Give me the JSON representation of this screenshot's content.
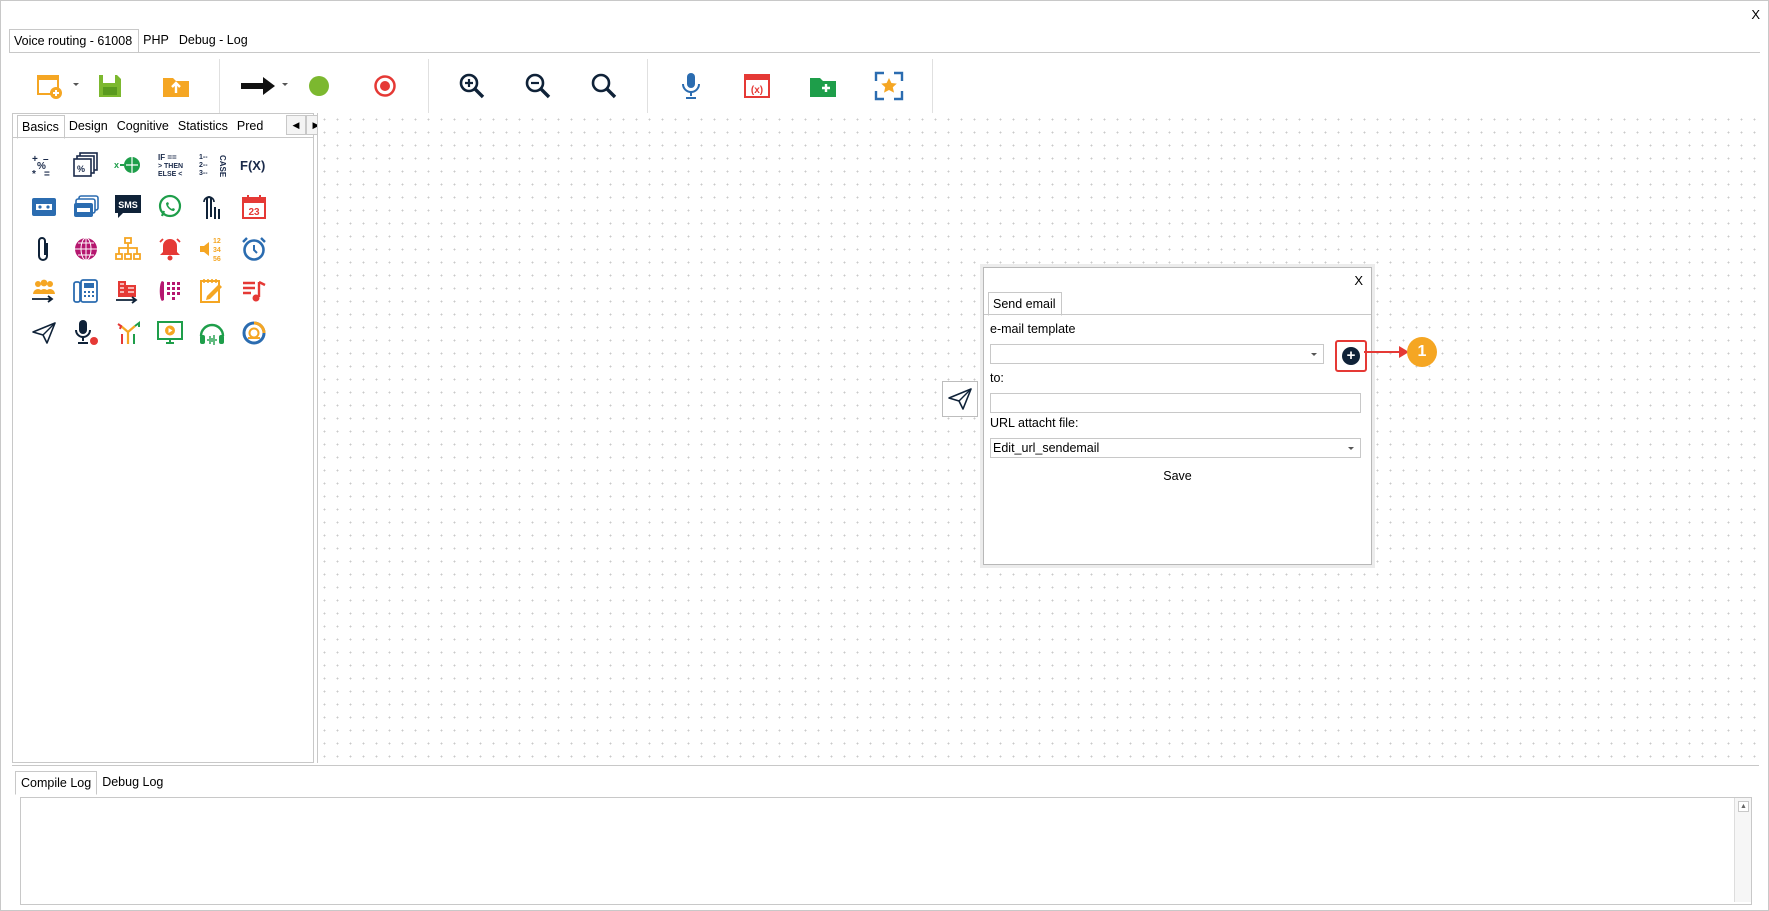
{
  "window": {
    "close_label": "X"
  },
  "top_tabs": [
    {
      "label": "Voice routing - 61008",
      "active": true
    },
    {
      "label": "PHP",
      "active": false
    },
    {
      "label": "Debug - Log",
      "active": false
    }
  ],
  "toolbar": {
    "icons": [
      "new-diagram-icon",
      "save-icon",
      "upload-folder-icon",
      "arrow-right-icon",
      "start-dot-icon",
      "stop-target-icon",
      "zoom-in-icon",
      "zoom-out-icon",
      "zoom-reset-icon",
      "microphone-icon",
      "variables-icon",
      "add-folder-icon",
      "fit-to-screen-icon"
    ]
  },
  "left_panel": {
    "tabs": [
      {
        "label": "Basics",
        "active": true
      },
      {
        "label": "Design",
        "active": false
      },
      {
        "label": "Cognitive",
        "active": false
      },
      {
        "label": "Statistics",
        "active": false
      },
      {
        "label": "Pred",
        "active": false
      }
    ],
    "palette_text": {
      "if_then": "IF ==\n> THEN\nELSE <",
      "case": "CASE",
      "fx": "F(X)",
      "sms": "SMS",
      "date": "23",
      "numbers": "12\n34\n56"
    }
  },
  "dialog": {
    "close_label": "X",
    "tab_label": "Send email",
    "email_template_label": "e-mail template",
    "email_template_value": "",
    "to_label": "to:",
    "to_value": "",
    "url_label": "URL attacht file:",
    "url_value": "Edit_url_sendemail",
    "save_label": "Save",
    "add_button_glyph": "+",
    "callout_number": "1"
  },
  "log": {
    "tabs": [
      {
        "label": "Compile Log",
        "active": true
      },
      {
        "label": "Debug Log",
        "active": false
      }
    ],
    "content": ""
  },
  "colors": {
    "accent_red": "#e53935",
    "badge_orange": "#f5a623",
    "navy": "#0f2238",
    "green": "#7cb82f",
    "orange": "#f5a623"
  }
}
